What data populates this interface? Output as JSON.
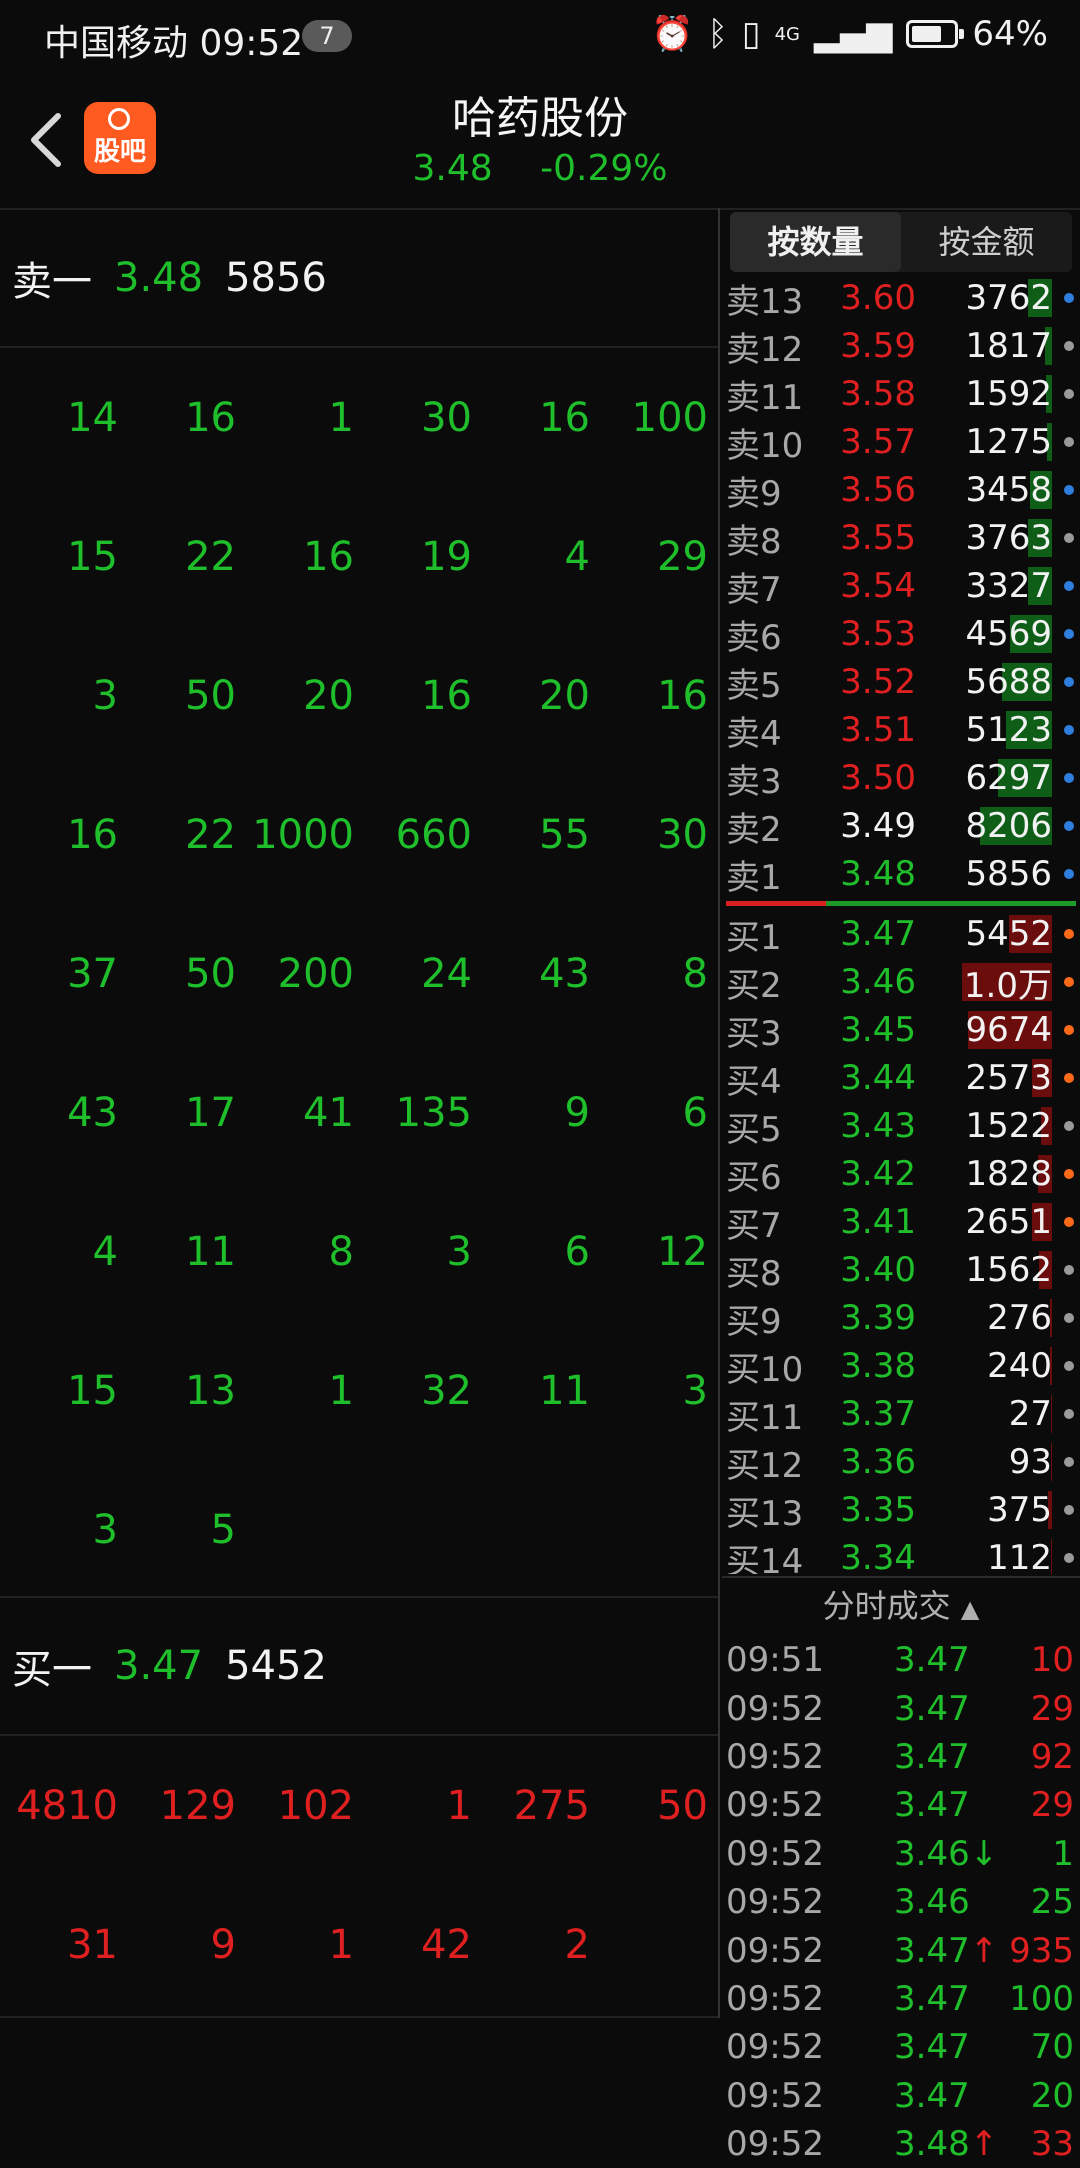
{
  "status_bar": {
    "carrier_time": "中国移动 09:52",
    "notification_count": "7",
    "network": "4G",
    "battery": "64%"
  },
  "header": {
    "app_logo_text": "股吧",
    "stock_name": "哈药股份",
    "price": "3.48",
    "change": "-0.29%"
  },
  "left_panel": {
    "sell_one": {
      "label": "卖一",
      "price": "3.48",
      "volume": "5856"
    },
    "sell_queue": [
      [
        "14",
        "16",
        "1",
        "30",
        "16",
        "100"
      ],
      [
        "15",
        "22",
        "16",
        "19",
        "4",
        "29"
      ],
      [
        "3",
        "50",
        "20",
        "16",
        "20",
        "16"
      ],
      [
        "16",
        "22",
        "1000",
        "660",
        "55",
        "30"
      ],
      [
        "37",
        "50",
        "200",
        "24",
        "43",
        "8"
      ],
      [
        "43",
        "17",
        "41",
        "135",
        "9",
        "6"
      ],
      [
        "4",
        "11",
        "8",
        "3",
        "6",
        "12"
      ],
      [
        "15",
        "13",
        "1",
        "32",
        "11",
        "3"
      ],
      [
        "3",
        "5",
        "",
        "",
        "",
        ""
      ]
    ],
    "buy_one": {
      "label": "买一",
      "price": "3.47",
      "volume": "5452"
    },
    "buy_queue": [
      [
        "4810",
        "129",
        "102",
        "1",
        "275",
        "50"
      ],
      [
        "31",
        "9",
        "1",
        "42",
        "2",
        ""
      ]
    ]
  },
  "order_book": {
    "tabs": [
      "按数量",
      "按金额"
    ],
    "active_tab": 0,
    "asks": [
      {
        "label": "卖13",
        "price": "3.60",
        "volume": "3762",
        "fill": 0.2,
        "dot": "#2f7fe0"
      },
      {
        "label": "卖12",
        "price": "3.59",
        "volume": "1817",
        "fill": 0.06,
        "dot": "#9a9a9a"
      },
      {
        "label": "卖11",
        "price": "3.58",
        "volume": "1592",
        "fill": 0.05,
        "dot": "#9a9a9a"
      },
      {
        "label": "卖10",
        "price": "3.57",
        "volume": "1275",
        "fill": 0.04,
        "dot": "#9a9a9a"
      },
      {
        "label": "卖9",
        "price": "3.56",
        "volume": "3458",
        "fill": 0.18,
        "dot": "#2f7fe0"
      },
      {
        "label": "卖8",
        "price": "3.55",
        "volume": "3763",
        "fill": 0.2,
        "dot": "#9a9a9a"
      },
      {
        "label": "卖7",
        "price": "3.54",
        "volume": "3327",
        "fill": 0.2,
        "dot": "#2f7fe0"
      },
      {
        "label": "卖6",
        "price": "3.53",
        "volume": "4569",
        "fill": 0.35,
        "dot": "#2f7fe0"
      },
      {
        "label": "卖5",
        "price": "3.52",
        "volume": "5688",
        "fill": 0.42,
        "dot": "#2f7fe0"
      },
      {
        "label": "卖4",
        "price": "3.51",
        "volume": "5123",
        "fill": 0.38,
        "dot": "#2f7fe0"
      },
      {
        "label": "卖3",
        "price": "3.50",
        "volume": "6297",
        "fill": 0.45,
        "dot": "#2f7fe0"
      },
      {
        "label": "卖2",
        "price": "3.49",
        "volume": "8206",
        "fill": 0.6,
        "dot": "#2f7fe0"
      },
      {
        "label": "卖1",
        "price": "3.48",
        "volume": "5856",
        "fill": 0.0,
        "dot": "#2f7fe0"
      }
    ],
    "bids": [
      {
        "label": "买1",
        "price": "3.47",
        "volume": "5452",
        "fill": 0.36,
        "dot": "#ff6a1a"
      },
      {
        "label": "买2",
        "price": "3.46",
        "volume": "1.0万",
        "fill": 0.75,
        "dot": "#ff6a1a"
      },
      {
        "label": "买3",
        "price": "3.45",
        "volume": "9674",
        "fill": 0.7,
        "dot": "#ff6a1a"
      },
      {
        "label": "买4",
        "price": "3.44",
        "volume": "2573",
        "fill": 0.17,
        "dot": "#ff6a1a"
      },
      {
        "label": "买5",
        "price": "3.43",
        "volume": "1522",
        "fill": 0.09,
        "dot": "#9a9a9a"
      },
      {
        "label": "买6",
        "price": "3.42",
        "volume": "1828",
        "fill": 0.12,
        "dot": "#ff6a1a"
      },
      {
        "label": "买7",
        "price": "3.41",
        "volume": "2651",
        "fill": 0.17,
        "dot": "#ff6a1a"
      },
      {
        "label": "买8",
        "price": "3.40",
        "volume": "1562",
        "fill": 0.11,
        "dot": "#9a9a9a"
      },
      {
        "label": "买9",
        "price": "3.39",
        "volume": "276",
        "fill": 0.02,
        "dot": "#9a9a9a"
      },
      {
        "label": "买10",
        "price": "3.38",
        "volume": "240",
        "fill": 0.02,
        "dot": "#9a9a9a"
      },
      {
        "label": "买11",
        "price": "3.37",
        "volume": "27",
        "fill": 0.01,
        "dot": "#9a9a9a"
      },
      {
        "label": "买12",
        "price": "3.36",
        "volume": "93",
        "fill": 0.01,
        "dot": "#9a9a9a"
      },
      {
        "label": "买13",
        "price": "3.35",
        "volume": "375",
        "fill": 0.03,
        "dot": "#9a9a9a"
      },
      {
        "label": "买14",
        "price": "3.34",
        "volume": "112",
        "fill": 0.01,
        "dot": "#9a9a9a"
      }
    ]
  },
  "trades": {
    "title": "分时成交",
    "rows": [
      {
        "time": "09:51",
        "price": "3.47",
        "arrow": "",
        "volume": "10",
        "color": "red"
      },
      {
        "time": "09:52",
        "price": "3.47",
        "arrow": "",
        "volume": "29",
        "color": "red"
      },
      {
        "time": "09:52",
        "price": "3.47",
        "arrow": "",
        "volume": "92",
        "color": "red"
      },
      {
        "time": "09:52",
        "price": "3.47",
        "arrow": "",
        "volume": "29",
        "color": "red"
      },
      {
        "time": "09:52",
        "price": "3.46",
        "arrow": "↓",
        "volume": "1",
        "color": "green"
      },
      {
        "time": "09:52",
        "price": "3.46",
        "arrow": "",
        "volume": "25",
        "color": "green"
      },
      {
        "time": "09:52",
        "price": "3.47",
        "arrow": "↑",
        "volume": "935",
        "color": "red"
      },
      {
        "time": "09:52",
        "price": "3.47",
        "arrow": "",
        "volume": "100",
        "color": "green"
      },
      {
        "time": "09:52",
        "price": "3.47",
        "arrow": "",
        "volume": "70",
        "color": "green"
      },
      {
        "time": "09:52",
        "price": "3.47",
        "arrow": "",
        "volume": "20",
        "color": "green"
      },
      {
        "time": "09:52",
        "price": "3.48",
        "arrow": "↑",
        "volume": "33",
        "color": "red"
      }
    ]
  },
  "colors": {
    "up": "#e02020",
    "down": "#1fbf2b",
    "ask_bar": "#0f5e17",
    "bid_bar": "#6b0d0d"
  }
}
